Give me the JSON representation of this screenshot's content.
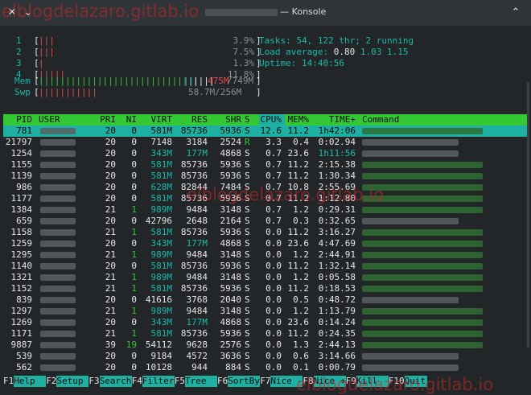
{
  "window": {
    "title": "— Konsole",
    "close_glyph": "✕",
    "menu_glyph": "⌄",
    "collapse_glyph": "⌃"
  },
  "meters": {
    "cpus": [
      {
        "label": "1",
        "bar": "|||",
        "percent": "3.9%"
      },
      {
        "label": "2",
        "bar": "|||",
        "percent": "7.5%"
      },
      {
        "label": "3",
        "bar": "|",
        "percent": "1.3%"
      },
      {
        "label": "4",
        "bar": "|||||",
        "percent": "11.8%"
      }
    ],
    "mem": {
      "label": "Mem",
      "bar_green": "||||||||||||||||||||||||||||||",
      "bar_blue": "||",
      "bar_yellow": "||||",
      "value_red": "475M",
      "value_rest": "/749M"
    },
    "swp": {
      "label": "Swp",
      "bar": "|||||||||||",
      "value": "58.7M/256M"
    }
  },
  "summary": {
    "tasks_label": "Tasks: ",
    "tasks": "54",
    "thr_sep": ", ",
    "thr": "122",
    "thr_label": " thr; ",
    "running": "2",
    "running_label": " running",
    "load_label": "Load average: ",
    "load1": "0.80",
    "load5": "1.03",
    "load15": "1.15",
    "uptime_label": "Uptime: ",
    "uptime": "14:40:56"
  },
  "table": {
    "columns": [
      "PID",
      "USER",
      "PRI",
      "NI",
      "VIRT",
      "RES",
      "SHR",
      "S",
      "CPU%",
      "MEM%",
      "TIME+",
      "Command"
    ],
    "rows": [
      {
        "pid": "781",
        "pri": "20",
        "ni": "0",
        "virt": "581M",
        "res": "85736",
        "shr": "5936",
        "s": "S",
        "cpu": "12.6",
        "mem": "11.2",
        "time": "1h42:06",
        "cmd": "g"
      },
      {
        "pid": "21797",
        "pri": "20",
        "ni": "0",
        "virt": "7148",
        "res": "3184",
        "shr": "2524",
        "s": "R",
        "cpu": "3.3",
        "mem": "0.4",
        "time": "0:02.94",
        "cmd": "w"
      },
      {
        "pid": "1254",
        "pri": "20",
        "ni": "0",
        "virt": "343M",
        "res": "177M",
        "shr": "4868",
        "s": "S",
        "cpu": "0.7",
        "mem": "23.6",
        "time": "1h11:56",
        "cmd": "w"
      },
      {
        "pid": "1155",
        "pri": "20",
        "ni": "0",
        "virt": "581M",
        "res": "85736",
        "shr": "5936",
        "s": "S",
        "cpu": "0.7",
        "mem": "11.2",
        "time": "2:15.38",
        "cmd": "g"
      },
      {
        "pid": "1139",
        "pri": "20",
        "ni": "0",
        "virt": "581M",
        "res": "85736",
        "shr": "5936",
        "s": "S",
        "cpu": "0.7",
        "mem": "11.2",
        "time": "1:30.34",
        "cmd": "g"
      },
      {
        "pid": "986",
        "pri": "20",
        "ni": "0",
        "virt": "628M",
        "res": "82844",
        "shr": "7484",
        "s": "S",
        "cpu": "0.7",
        "mem": "10.8",
        "time": "2:55.69",
        "cmd": "g"
      },
      {
        "pid": "1177",
        "pri": "20",
        "ni": "0",
        "virt": "581M",
        "res": "85736",
        "shr": "5936",
        "s": "S",
        "cpu": "0.7",
        "mem": "11.2",
        "time": "1:12.80",
        "cmd": "g"
      },
      {
        "pid": "1384",
        "pri": "21",
        "ni": "1",
        "virt": "989M",
        "res": "9484",
        "shr": "3148",
        "s": "S",
        "cpu": "0.7",
        "mem": "1.2",
        "time": "0:29.31",
        "cmd": "g"
      },
      {
        "pid": "659",
        "pri": "20",
        "ni": "0",
        "virt": "42796",
        "res": "2648",
        "shr": "2164",
        "s": "S",
        "cpu": "0.7",
        "mem": "0.3",
        "time": "0:32.65",
        "cmd": "w"
      },
      {
        "pid": "1158",
        "pri": "21",
        "ni": "1",
        "virt": "581M",
        "res": "85736",
        "shr": "5936",
        "s": "S",
        "cpu": "0.0",
        "mem": "11.2",
        "time": "3:16.27",
        "cmd": "g"
      },
      {
        "pid": "1259",
        "pri": "20",
        "ni": "0",
        "virt": "343M",
        "res": "177M",
        "shr": "4868",
        "s": "S",
        "cpu": "0.0",
        "mem": "23.6",
        "time": "4:47.69",
        "cmd": "g"
      },
      {
        "pid": "1295",
        "pri": "21",
        "ni": "1",
        "virt": "989M",
        "res": "9484",
        "shr": "3148",
        "s": "S",
        "cpu": "0.0",
        "mem": "1.2",
        "time": "2:44.91",
        "cmd": "g"
      },
      {
        "pid": "1140",
        "pri": "20",
        "ni": "0",
        "virt": "581M",
        "res": "85736",
        "shr": "5936",
        "s": "S",
        "cpu": "0.0",
        "mem": "11.2",
        "time": "1:32.14",
        "cmd": "g"
      },
      {
        "pid": "1321",
        "pri": "21",
        "ni": "1",
        "virt": "989M",
        "res": "9484",
        "shr": "3148",
        "s": "S",
        "cpu": "0.0",
        "mem": "1.2",
        "time": "0:05.58",
        "cmd": "g"
      },
      {
        "pid": "1152",
        "pri": "21",
        "ni": "1",
        "virt": "581M",
        "res": "85736",
        "shr": "5936",
        "s": "S",
        "cpu": "0.0",
        "mem": "11.2",
        "time": "0:18.53",
        "cmd": "g"
      },
      {
        "pid": "839",
        "pri": "20",
        "ni": "0",
        "virt": "41616",
        "res": "3768",
        "shr": "2040",
        "s": "S",
        "cpu": "0.0",
        "mem": "0.5",
        "time": "0:48.72",
        "cmd": "w"
      },
      {
        "pid": "1297",
        "pri": "21",
        "ni": "1",
        "virt": "989M",
        "res": "9484",
        "shr": "3148",
        "s": "S",
        "cpu": "0.0",
        "mem": "1.2",
        "time": "1:13.79",
        "cmd": "g"
      },
      {
        "pid": "1269",
        "pri": "20",
        "ni": "0",
        "virt": "343M",
        "res": "177M",
        "shr": "4868",
        "s": "S",
        "cpu": "0.0",
        "mem": "23.6",
        "time": "0:14.24",
        "cmd": "g"
      },
      {
        "pid": "1171",
        "pri": "21",
        "ni": "1",
        "virt": "581M",
        "res": "85736",
        "shr": "5936",
        "s": "S",
        "cpu": "0.0",
        "mem": "11.2",
        "time": "0:24.35",
        "cmd": "g"
      },
      {
        "pid": "9887",
        "pri": "39",
        "ni": "19",
        "virt": "54112",
        "res": "9628",
        "shr": "2576",
        "s": "S",
        "cpu": "0.0",
        "mem": "1.3",
        "time": "2:44.13",
        "cmd": "g"
      },
      {
        "pid": "539",
        "pri": "20",
        "ni": "0",
        "virt": "9184",
        "res": "4572",
        "shr": "3636",
        "s": "S",
        "cpu": "0.0",
        "mem": "0.6",
        "time": "3:14.66",
        "cmd": "w"
      },
      {
        "pid": "562",
        "pri": "20",
        "ni": "0",
        "virt": "10128",
        "res": "944",
        "shr": "884",
        "s": "S",
        "cpu": "0.0",
        "mem": "0.1",
        "time": "0:00.79",
        "cmd": "w"
      }
    ]
  },
  "footer": [
    {
      "key": "F1",
      "label": "Help  "
    },
    {
      "key": "F2",
      "label": "Setup "
    },
    {
      "key": "F3",
      "label": "Search"
    },
    {
      "key": "F4",
      "label": "Filter"
    },
    {
      "key": "F5",
      "label": "Tree  "
    },
    {
      "key": "F6",
      "label": "SortBy"
    },
    {
      "key": "F7",
      "label": "Nice -"
    },
    {
      "key": "F8",
      "label": "Nice +"
    },
    {
      "key": "F9",
      "label": "Kill  "
    },
    {
      "key": "F10",
      "label": "Quit"
    }
  ],
  "watermark": "elblogdelazaro.gitlab.io"
}
